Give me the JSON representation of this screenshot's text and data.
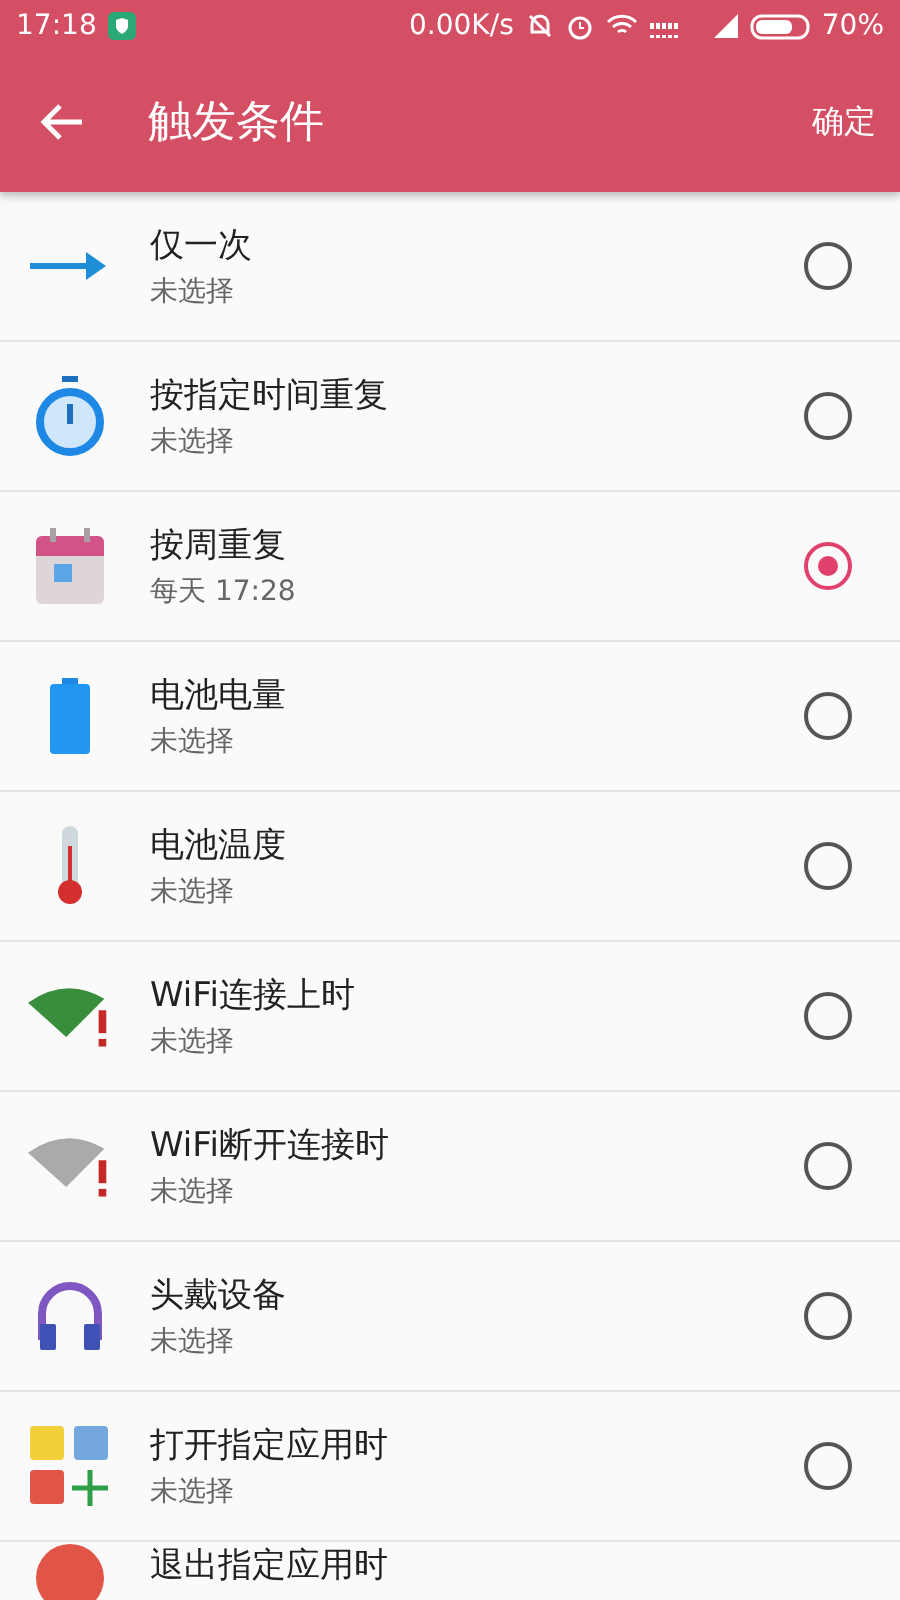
{
  "status_bar": {
    "time": "17:18",
    "speed": "0.00K/s",
    "battery": "70%"
  },
  "toolbar": {
    "title": "触发条件",
    "action": "确定"
  },
  "options": [
    {
      "title": "仅一次",
      "subtitle": "未选择",
      "selected": false
    },
    {
      "title": "按指定时间重复",
      "subtitle": "未选择",
      "selected": false
    },
    {
      "title": "按周重复",
      "subtitle": "每天 17:28",
      "selected": true
    },
    {
      "title": "电池电量",
      "subtitle": "未选择",
      "selected": false
    },
    {
      "title": "电池温度",
      "subtitle": "未选择",
      "selected": false
    },
    {
      "title": "WiFi连接上时",
      "subtitle": "未选择",
      "selected": false
    },
    {
      "title": "WiFi断开连接时",
      "subtitle": "未选择",
      "selected": false
    },
    {
      "title": "头戴设备",
      "subtitle": "未选择",
      "selected": false
    },
    {
      "title": "打开指定应用时",
      "subtitle": "未选择",
      "selected": false
    },
    {
      "title": "退出指定应用时"
    }
  ]
}
